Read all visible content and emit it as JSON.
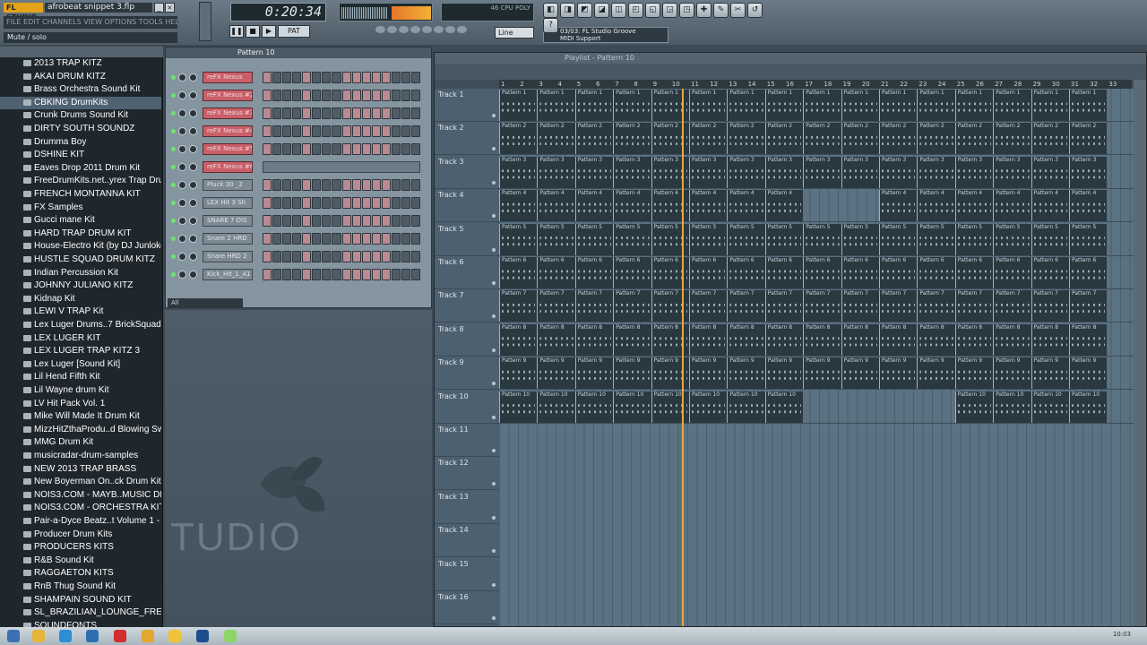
{
  "app": {
    "logo": "FL STUDIO",
    "project_file": "afrobeat snippet 3.flp",
    "hint": "Mute / solo",
    "menu_text": "FILE EDIT CHANNELS VIEW OPTIONS TOOLS HELP"
  },
  "transport": {
    "time": "0:20:34",
    "pat_label": "PAT",
    "song_label": "SONG",
    "play": "▶",
    "stop": "■",
    "rec": "●",
    "pause": "❚❚"
  },
  "cpu": {
    "text": "46 CPU POLY"
  },
  "pattern_selector": "Line",
  "midi": {
    "line1": "03/03: FL Studio Groove",
    "line2": "MIDI Support"
  },
  "tools": [
    "◧",
    "◨",
    "◩",
    "◪",
    "◫",
    "◰",
    "◱",
    "◲",
    "◳",
    "✚",
    "✎",
    "✂",
    "↺",
    "?"
  ],
  "browser": {
    "items": [
      "2013 TRAP KITZ",
      "AKAI DRUM KITZ",
      "Brass Orchestra Sound Kit",
      "CBKING DrumKits",
      "Crunk Drums Sound Kit",
      "DIRTY SOUTH SOUNDZ",
      "Drumma Boy",
      "DSHINE KIT",
      "Eaves Drop 2011 Drum Kit",
      "FreeDrumKits.net..yrex Trap Drum Kit",
      "FRENCH MONTANNA KIT",
      "FX Samples",
      "Gucci mane Kit",
      "HARD TRAP DRUM KIT",
      "House-Electro Kit (by DJ Junloke)",
      "HUSTLE SQUAD DRUM KITZ",
      "Indian Percussion Kit",
      "JOHNNY JULIANO KITZ",
      "Kidnap Kit",
      "LEWI V TRAP Kit",
      "Lex Luger Drums..7 BrickSquad Bundle",
      "LEX LUGER KIT",
      "LEX LUGER TRAP KITZ 3",
      "Lex Luger [Sound Kit]",
      "Lil Hend Fifth Kit",
      "Lil Wayne drum Kit",
      "LV Hit Pack Vol. 1",
      "Mike Will Made It Drum Kit",
      "MizzHitZthaProdu..d Blowing Swag Kit",
      "MMG Drum Kit",
      "musicradar-drum-samples",
      "NEW 2013 TRAP BRASS",
      "New Boyerman On..ck Drum Kit Vol 1",
      "NOIS3.COM - MAYB..MUSIC DRUM KIT",
      "NOIS3.COM - ORCHESTRA KIT",
      "Pair-a-Dyce Beatz..t Volume 1 - Copy",
      "Producer Drum Kits",
      "PRODUCERS KITS",
      "R&B Sound Kit",
      "RAGGAETON KITS",
      "RnB Thug Sound Kit",
      "SHAMPAIN SOUND KIT",
      "SL_BRAZILIAN_LOUNGE_FREE",
      "SOUNDFONTS"
    ],
    "selected_index": 3
  },
  "sequencer": {
    "title": "Pattern 10",
    "filter": "All",
    "channels": [
      {
        "name": "reFX Nexus",
        "color": "red"
      },
      {
        "name": "reFX Nexus #2",
        "color": "red"
      },
      {
        "name": "reFX Nexus #3",
        "color": "red"
      },
      {
        "name": "reFX Nexus #4",
        "color": "red"
      },
      {
        "name": "reFX Nexus #5",
        "color": "red"
      },
      {
        "name": "reFX Nexus #6",
        "color": "red"
      },
      {
        "name": "Pluck 30 _2",
        "color": "gray"
      },
      {
        "name": "LEX Hit 3 Sh",
        "color": "gray"
      },
      {
        "name": "SNARE 7 DIS",
        "color": "gray"
      },
      {
        "name": "Snare 2 HRD",
        "color": "gray"
      },
      {
        "name": "Snare HRD 2",
        "color": "gray"
      },
      {
        "name": "Kick_Hit_1_A1",
        "color": "gray"
      }
    ]
  },
  "watermark": "TUDIO",
  "playlist": {
    "title": "Playlist - Pattern 10",
    "ruler": [
      "1",
      "2",
      "3",
      "4",
      "5",
      "6",
      "7",
      "8",
      "9",
      "10",
      "11",
      "12",
      "13",
      "14",
      "15",
      "16",
      "17",
      "18",
      "19",
      "20",
      "21",
      "22",
      "23",
      "24",
      "25",
      "26",
      "27",
      "28",
      "29",
      "30",
      "31",
      "32",
      "33"
    ],
    "tracks": [
      "Track 1",
      "Track 2",
      "Track 3",
      "Track 4",
      "Track 5",
      "Track 6",
      "Track 7",
      "Track 8",
      "Track 9",
      "Track 10",
      "Track 11",
      "Track 12",
      "Track 13",
      "Track 14",
      "Track 15",
      "Track 16"
    ],
    "rows": [
      {
        "label": "Pattern 1",
        "ranges": [
          [
            0,
            32
          ]
        ]
      },
      {
        "label": "Pattern 2",
        "ranges": [
          [
            0,
            32
          ]
        ]
      },
      {
        "label": "Pattern 3",
        "ranges": [
          [
            0,
            32
          ]
        ]
      },
      {
        "label": "Pattern 4",
        "ranges": [
          [
            0,
            16
          ],
          [
            20,
            32
          ]
        ]
      },
      {
        "label": "Pattern 5",
        "ranges": [
          [
            0,
            32
          ]
        ]
      },
      {
        "label": "Pattern 6",
        "ranges": [
          [
            0,
            32
          ]
        ]
      },
      {
        "label": "Pattern 7",
        "ranges": [
          [
            0,
            32
          ]
        ]
      },
      {
        "label": "Pattern 8",
        "ranges": [
          [
            0,
            32
          ]
        ]
      },
      {
        "label": "Pattern 9",
        "ranges": [
          [
            0,
            32
          ]
        ]
      },
      {
        "label": "Pattern 10",
        "ranges": [
          [
            0,
            16
          ],
          [
            24,
            32
          ]
        ]
      }
    ],
    "playhead_bar": 10.6
  },
  "taskbar": {
    "time": "10:03"
  }
}
